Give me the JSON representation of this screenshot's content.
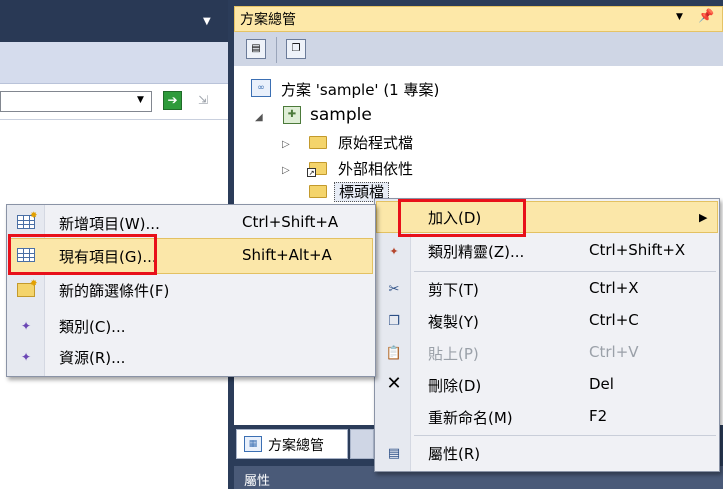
{
  "solution_explorer": {
    "title": "方案總管",
    "title_dropdown_icon": "dropdown-icon",
    "pin_icon": "pin-icon",
    "toolbar": [
      {
        "name": "properties-icon"
      },
      {
        "name": "show-all-files-icon"
      }
    ],
    "tree": {
      "solution_label": "方案 'sample' (1 專案)",
      "project_label": "sample",
      "folders": [
        {
          "label": "原始程式檔",
          "expander": "▷"
        },
        {
          "label": "外部相依性",
          "expander": "▷"
        },
        {
          "label": "標頭檔",
          "expander": ""
        }
      ]
    },
    "tabs": [
      {
        "label": "方案總管"
      }
    ],
    "properties_label": "屬性"
  },
  "context_menu": {
    "items": [
      {
        "label": "加入(D)",
        "shortcut": "",
        "icon": "",
        "submenu_arrow": "▶",
        "enabled": true
      },
      {
        "label": "類別精靈(Z)...",
        "shortcut": "Ctrl+Shift+X",
        "icon": "class-wizard-icon",
        "enabled": true
      },
      {
        "label": "剪下(T)",
        "shortcut": "Ctrl+X",
        "icon": "cut-icon",
        "enabled": true
      },
      {
        "label": "複製(Y)",
        "shortcut": "Ctrl+C",
        "icon": "copy-icon",
        "enabled": true
      },
      {
        "label": "貼上(P)",
        "shortcut": "Ctrl+V",
        "icon": "paste-icon",
        "enabled": false
      },
      {
        "label": "刪除(D)",
        "shortcut": "Del",
        "icon": "delete-icon",
        "enabled": true
      },
      {
        "label": "重新命名(M)",
        "shortcut": "F2",
        "icon": "",
        "enabled": true
      },
      {
        "label": "屬性(R)",
        "shortcut": "",
        "icon": "properties-icon",
        "enabled": true
      }
    ]
  },
  "add_submenu": {
    "items": [
      {
        "label": "新增項目(W)...",
        "shortcut": "Ctrl+Shift+A",
        "icon": "new-item-icon"
      },
      {
        "label": "現有項目(G)...",
        "shortcut": "Shift+Alt+A",
        "icon": "existing-item-icon"
      },
      {
        "label": "新的篩選條件(F)",
        "shortcut": "",
        "icon": "new-filter-icon"
      },
      {
        "label": "類別(C)...",
        "shortcut": "",
        "icon": "class-icon"
      },
      {
        "label": "資源(R)...",
        "shortcut": "",
        "icon": "resource-icon"
      }
    ]
  },
  "colors": {
    "highlight": "#fbe7a9",
    "red_frame": "#e8101a",
    "ide_dark": "#2b3c59",
    "disabled_text": "#9aa0a8"
  }
}
